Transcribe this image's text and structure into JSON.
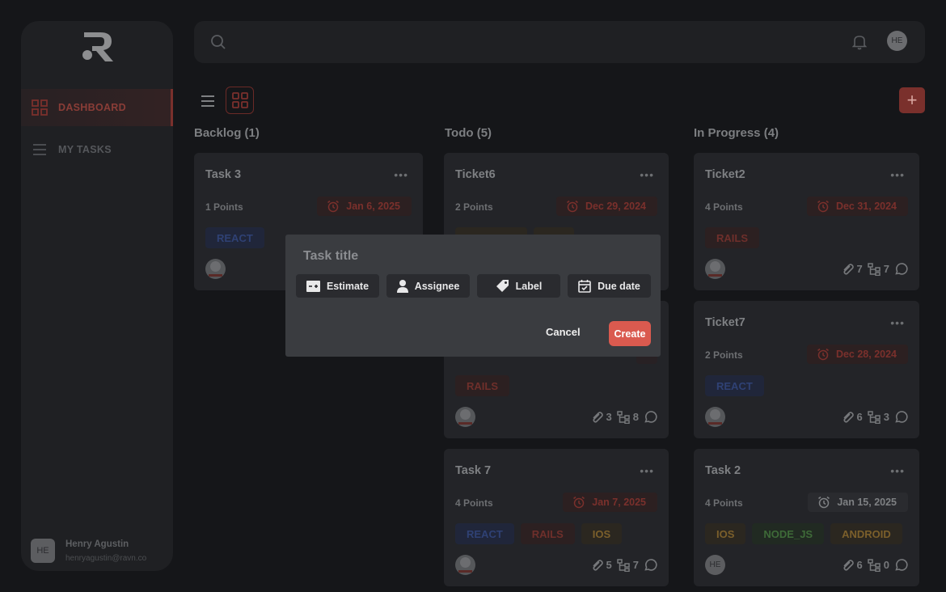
{
  "sidebar": {
    "nav": [
      {
        "label": "DASHBOARD",
        "icon": "grid-icon"
      },
      {
        "label": "MY TASKS",
        "icon": "list-icon"
      }
    ],
    "user": {
      "initials": "HE",
      "name": "Henry Agustin",
      "email": "henryagustin@ravn.co"
    }
  },
  "header": {
    "avatar_initials": "HE"
  },
  "colors": {
    "accent": "#da5a4f",
    "background": "#151619",
    "panel": "#1f2023"
  },
  "columns": [
    {
      "title": "Backlog (1)",
      "cards": [
        {
          "title": "Task 3",
          "points": "1 Points",
          "due": "Jan 6, 2025",
          "tags": [
            "REACT"
          ]
        }
      ]
    },
    {
      "title": "Todo (5)",
      "cards": [
        {
          "title": "Ticket6",
          "points": "2 Points",
          "due": "Dec 29, 2024",
          "tags": [
            "ANDROID",
            "IOS"
          ]
        },
        {
          "title": "",
          "points": "",
          "due": "",
          "tags": [
            "RAILS"
          ],
          "attachments": "3",
          "subtasks": "8"
        },
        {
          "title": "Task 7",
          "points": "4 Points",
          "due": "Jan 7, 2025",
          "tags": [
            "REACT",
            "RAILS",
            "IOS"
          ],
          "attachments": "5",
          "subtasks": "7"
        }
      ]
    },
    {
      "title": "In Progress (4)",
      "cards": [
        {
          "title": "Ticket2",
          "points": "4 Points",
          "due": "Dec 31, 2024",
          "tags": [
            "RAILS"
          ],
          "attachments": "7",
          "subtasks": "7"
        },
        {
          "title": "Ticket7",
          "points": "2 Points",
          "due": "Dec 28, 2024",
          "tags": [
            "REACT"
          ],
          "attachments": "6",
          "subtasks": "3"
        },
        {
          "title": "Task 2",
          "points": "4 Points",
          "due": "Jan 15, 2025",
          "tags": [
            "IOS",
            "NODE_JS",
            "ANDROID"
          ],
          "attachments": "6",
          "subtasks": "0",
          "assignee_initials": "HE"
        }
      ]
    }
  ],
  "modal": {
    "title_placeholder": "Task title",
    "options": [
      {
        "label": "Estimate",
        "icon": "estimate-icon"
      },
      {
        "label": "Assignee",
        "icon": "person-icon"
      },
      {
        "label": "Label",
        "icon": "tag-icon"
      },
      {
        "label": "Due date",
        "icon": "calendar-icon"
      }
    ],
    "cancel_label": "Cancel",
    "create_label": "Create"
  }
}
